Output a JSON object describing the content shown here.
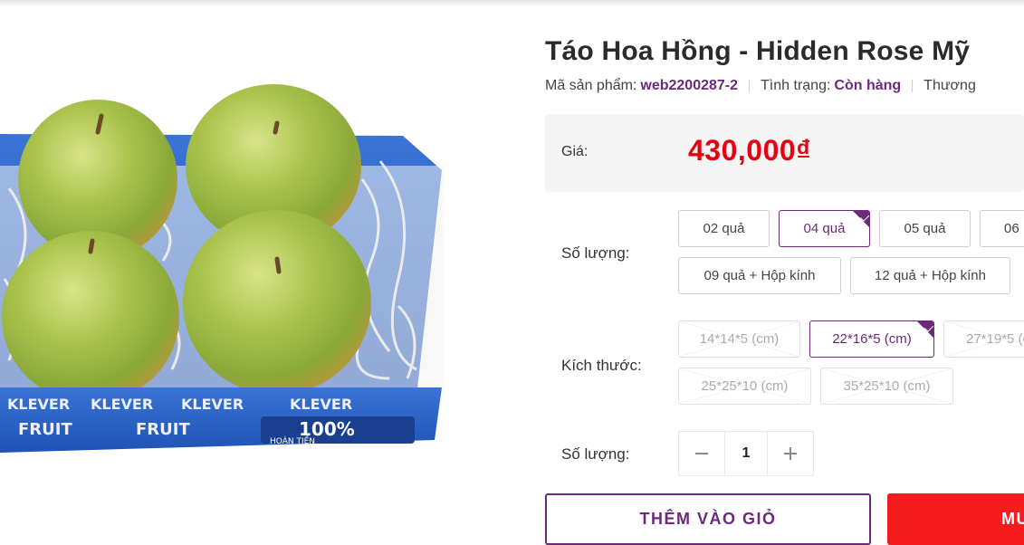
{
  "product": {
    "title": "Táo Hoa Hồng - Hidden Rose Mỹ",
    "sku_label": "Mã sản phẩm:",
    "sku_value": "web2200287-2",
    "status_label": "Tình trạng:",
    "status_value": "Còn hàng",
    "brand_label": "Thương"
  },
  "image": {
    "box_brand": "KLEVER",
    "box_brand_sub": "FRUIT",
    "badge_text": "100%",
    "badge_sub": "HOÀN TIỀN",
    "colors": {
      "apple": "#9bbf3c",
      "box": "#2a63c9",
      "paper": "#f2f2f2"
    }
  },
  "price": {
    "label": "Giá:",
    "value": "430,000₫",
    "color": "#e60012"
  },
  "quantity_options": {
    "label": "Số lượng:",
    "items": [
      {
        "label": "02 quả",
        "selected": false
      },
      {
        "label": "04 quả",
        "selected": true
      },
      {
        "label": "05 quả",
        "selected": false
      },
      {
        "label": "06",
        "selected": false
      },
      {
        "label": "09 quả + Hộp kính",
        "selected": false
      },
      {
        "label": "12 quả + Hộp kính",
        "selected": false
      }
    ]
  },
  "size_options": {
    "label": "Kích thước:",
    "items": [
      {
        "label": "14*14*5 (cm)",
        "selected": false,
        "disabled": true
      },
      {
        "label": "22*16*5 (cm)",
        "selected": true,
        "disabled": false
      },
      {
        "label": "27*19*5 (c",
        "selected": false,
        "disabled": true
      },
      {
        "label": "25*25*10 (cm)",
        "selected": false,
        "disabled": true
      },
      {
        "label": "35*25*10 (cm)",
        "selected": false,
        "disabled": true
      }
    ]
  },
  "quantity": {
    "label": "Số lượng:",
    "value": "1",
    "minus_icon": "minus-icon",
    "plus_icon": "plus-icon"
  },
  "actions": {
    "add_to_cart": "THÊM VÀO GIỎ",
    "buy_now": "MU",
    "accent": "#6b2a7a",
    "buy_color": "#f41c1c"
  }
}
